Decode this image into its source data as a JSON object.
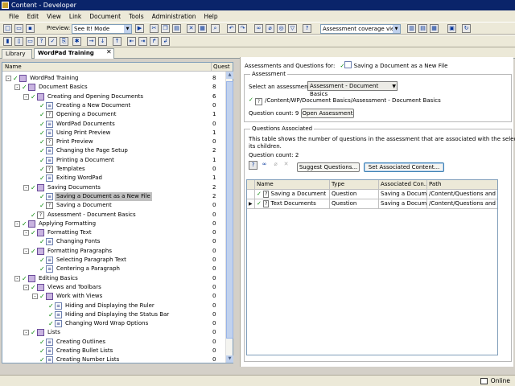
{
  "window": {
    "title": "Content - Developer"
  },
  "menu": [
    "File",
    "Edit",
    "View",
    "Link",
    "Document",
    "Tools",
    "Administration",
    "Help"
  ],
  "toolbar": {
    "preview_label": "Preview:",
    "preview_mode": "See It! Mode",
    "view_select": "Assessment coverage view"
  },
  "tabs": [
    {
      "label": "Library"
    },
    {
      "label": "WordPad Training"
    }
  ],
  "tree": {
    "header_name": "Name",
    "header_count": "Quest",
    "rows": [
      {
        "label": "WordPad Training",
        "count": "8",
        "level": 0,
        "type": "book",
        "exp": "-",
        "check": true
      },
      {
        "label": "Document Basics",
        "count": "8",
        "level": 1,
        "type": "book",
        "exp": "-",
        "check": true
      },
      {
        "label": "Creating and Opening Documents",
        "count": "6",
        "level": 2,
        "type": "book",
        "exp": "-",
        "check": true
      },
      {
        "label": "Creating a New Document",
        "count": "0",
        "level": 3,
        "type": "topic",
        "check": true
      },
      {
        "label": "Opening a Document",
        "count": "1",
        "level": 3,
        "type": "q",
        "check": true
      },
      {
        "label": "WordPad Documents",
        "count": "0",
        "level": 3,
        "type": "topic",
        "check": true
      },
      {
        "label": "Using Print Preview",
        "count": "1",
        "level": 3,
        "type": "topic",
        "check": true
      },
      {
        "label": "Print Preview",
        "count": "0",
        "level": 3,
        "type": "q",
        "check": true
      },
      {
        "label": "Changing the Page Setup",
        "count": "2",
        "level": 3,
        "type": "topic",
        "check": true
      },
      {
        "label": "Printing a Document",
        "count": "1",
        "level": 3,
        "type": "topic",
        "check": true
      },
      {
        "label": "Templates",
        "count": "0",
        "level": 3,
        "type": "q",
        "check": true
      },
      {
        "label": "Exiting WordPad",
        "count": "1",
        "level": 3,
        "type": "topic",
        "check": true
      },
      {
        "label": "Saving Documents",
        "count": "2",
        "level": 2,
        "type": "book",
        "exp": "-",
        "check": true
      },
      {
        "label": "Saving a Document as a New File",
        "count": "2",
        "level": 3,
        "type": "topic",
        "check": true,
        "selected": true
      },
      {
        "label": "Saving a Document",
        "count": "0",
        "level": 3,
        "type": "q",
        "check": true
      },
      {
        "label": "Assessment - Document Basics",
        "count": "0",
        "level": 2,
        "type": "q",
        "check": true
      },
      {
        "label": "Applying Formatting",
        "count": "0",
        "level": 1,
        "type": "book",
        "exp": "-",
        "check": true
      },
      {
        "label": "Formatting Text",
        "count": "0",
        "level": 2,
        "type": "book",
        "exp": "-",
        "check": true
      },
      {
        "label": "Changing Fonts",
        "count": "0",
        "level": 3,
        "type": "topic",
        "check": true
      },
      {
        "label": "Formatting Paragraphs",
        "count": "0",
        "level": 2,
        "type": "book",
        "exp": "-",
        "check": true
      },
      {
        "label": "Selecting Paragraph Text",
        "count": "0",
        "level": 3,
        "type": "topic",
        "check": true
      },
      {
        "label": "Centering a Paragraph",
        "count": "0",
        "level": 3,
        "type": "topic",
        "check": true
      },
      {
        "label": "Editing Basics",
        "count": "0",
        "level": 1,
        "type": "book",
        "exp": "-",
        "check": true
      },
      {
        "label": "Views and Toolbars",
        "count": "0",
        "level": 2,
        "type": "book",
        "exp": "-",
        "check": true
      },
      {
        "label": "Work with Views",
        "count": "0",
        "level": 3,
        "type": "book",
        "exp": "-",
        "check": true
      },
      {
        "label": "Hiding and Displaying the Ruler",
        "count": "0",
        "level": 4,
        "type": "topic",
        "check": true
      },
      {
        "label": "Hiding and Displaying the Status Bar",
        "count": "0",
        "level": 4,
        "type": "topic",
        "check": true
      },
      {
        "label": "Changing Word Wrap Options",
        "count": "0",
        "level": 4,
        "type": "topic",
        "check": true
      },
      {
        "label": "Lists",
        "count": "0",
        "level": 2,
        "type": "book",
        "exp": "-",
        "check": true
      },
      {
        "label": "Creating Outlines",
        "count": "0",
        "level": 3,
        "type": "topic",
        "check": true
      },
      {
        "label": "Creating Bullet Lists",
        "count": "0",
        "level": 3,
        "type": "topic",
        "check": true
      },
      {
        "label": "Creating Number Lists",
        "count": "0",
        "level": 3,
        "type": "topic",
        "check": true
      }
    ]
  },
  "right": {
    "heading": "Assessments and Questions for:",
    "heading_item": "Saving a Document as a New File",
    "assessment_group": "Assessment",
    "select_label": "Select an assessment:",
    "select_value": "Assessment - Document Basics",
    "path": "/Content/WP/Document Basics/Assessment - Document Basics",
    "question_count": "Question count: 9",
    "open_button": "Open Assessment",
    "questions_group": "Questions Associated",
    "desc_line1": "This table shows the number of questions in the assessment that are associated with the selection and",
    "desc_line2": "its children.",
    "assoc_count": "Question count: 2",
    "suggest_button": "Suggest Questions...",
    "set_button": "Set Associated Content...",
    "columns": [
      "Name",
      "Type",
      "Associated Con...",
      "Path"
    ],
    "rows": [
      {
        "name": "Saving a Document",
        "type": "Question",
        "assoc": "Saving a Docum...",
        "path": "/Content/Questions and A..."
      },
      {
        "name": "Text Documents",
        "type": "Question",
        "assoc": "Saving a Docum...",
        "path": "/Content/Questions and A..."
      }
    ]
  },
  "status": {
    "text": "Online"
  }
}
